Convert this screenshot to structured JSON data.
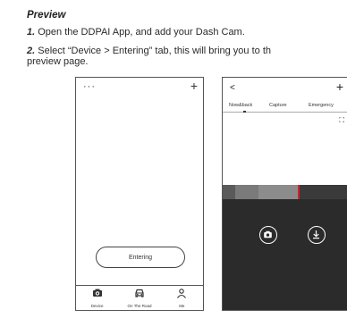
{
  "instructions": {
    "heading": "Preview",
    "step1_num": "1.",
    "step1_text": " Open the DDPAI App, and add your Dash Cam.",
    "step2_num": "2.",
    "step2_text_line1": " Select “Device > Entering” tab, this will bring you to th",
    "step2_text_line2": "preview page."
  },
  "phone_home": {
    "menu_dots": "···",
    "add_button": "+",
    "enter_button": "Entering",
    "tabs": [
      {
        "label": "Device",
        "icon": "camera-icon"
      },
      {
        "label": "On The Road",
        "icon": "car-icon"
      },
      {
        "label": "Me",
        "icon": "person-icon"
      }
    ]
  },
  "phone_preview": {
    "back_button": "<",
    "add_button": "+",
    "tabs": [
      "Now&back",
      "Capture",
      "Emergency"
    ],
    "expand_icon": "⛶",
    "buttons": [
      {
        "name": "capture-photo-button",
        "icon": "camera-icon"
      },
      {
        "name": "download-button",
        "icon": "download-icon"
      }
    ],
    "colors": {
      "timeline_marker": "#d4202a",
      "control_panel": "#2b2b2b"
    }
  }
}
